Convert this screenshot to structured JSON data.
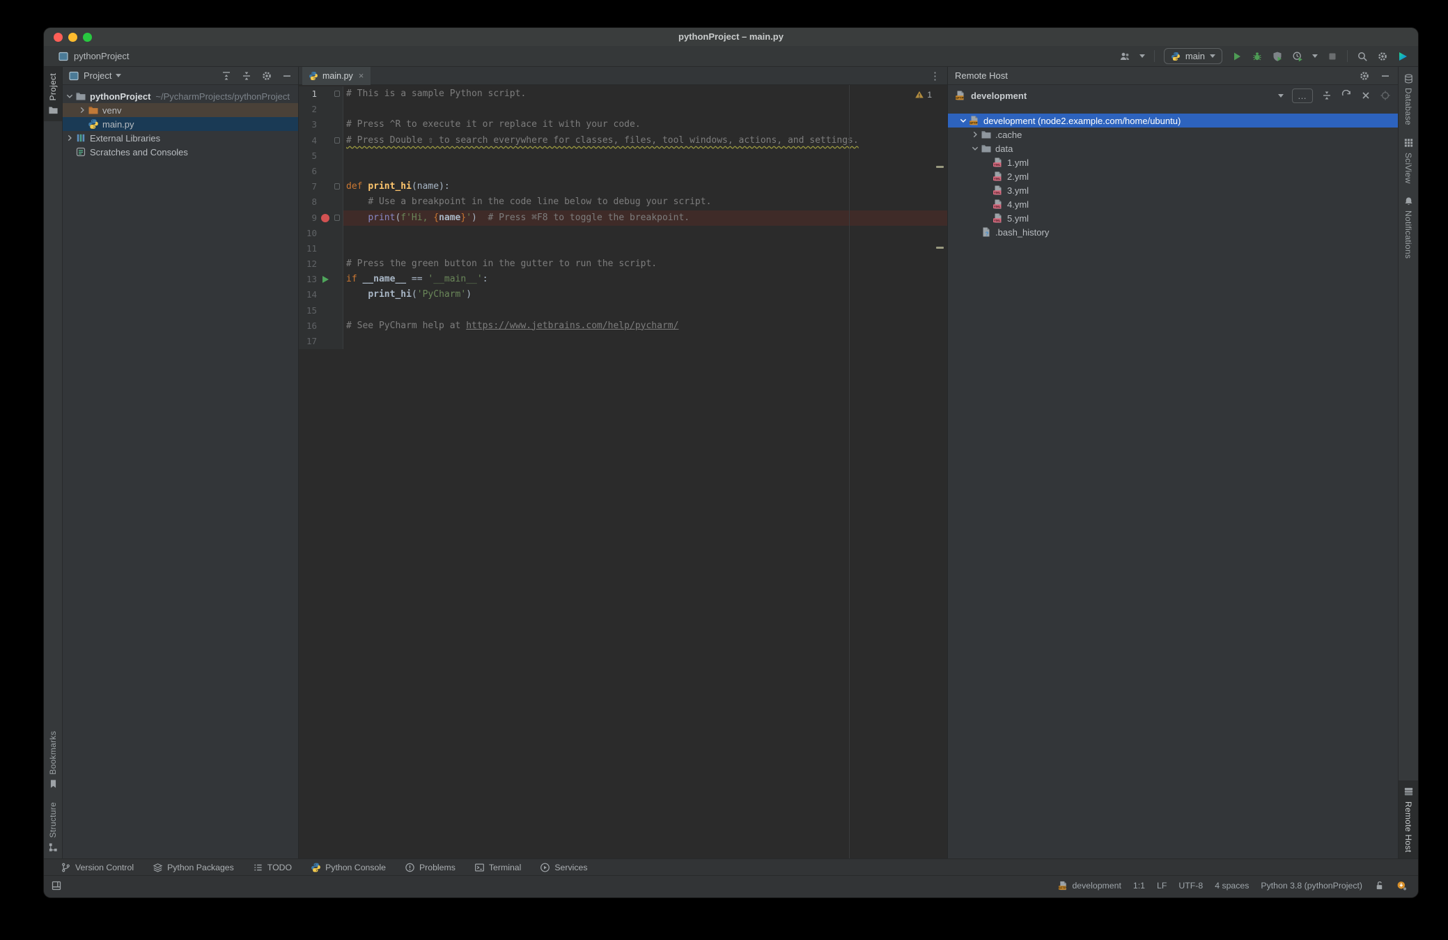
{
  "window": {
    "title": "pythonProject – main.py"
  },
  "navbar": {
    "project_label": "pythonProject",
    "run_config": "main",
    "right_icons": [
      "users",
      "run-pill",
      "play",
      "debug-bug",
      "coverage-shield",
      "profiler-clock",
      "caret",
      "stop",
      "separator",
      "search",
      "gear",
      "jetbrains-logo"
    ]
  },
  "stripes": {
    "left_top": [
      {
        "id": "project",
        "label": "Project",
        "icon": "folder-plain",
        "selected": true
      }
    ],
    "left_bottom": [
      {
        "id": "bookmarks",
        "label": "Bookmarks",
        "icon": "bookmark",
        "selected": false
      },
      {
        "id": "structure",
        "label": "Structure",
        "icon": "structure",
        "selected": false
      }
    ],
    "right_top": [
      {
        "id": "database",
        "label": "Database",
        "icon": "database",
        "selected": false
      },
      {
        "id": "sciview",
        "label": "SciView",
        "icon": "grid",
        "selected": false
      },
      {
        "id": "notifications",
        "label": "Notifications",
        "icon": "bell",
        "selected": false
      }
    ],
    "right_bottom": [
      {
        "id": "remote-host",
        "label": "Remote Host",
        "icon": "server",
        "selected": true
      }
    ]
  },
  "project_panel": {
    "title": "Project",
    "header_icons": [
      "expand-all",
      "collapse-all",
      "gear",
      "hide"
    ],
    "tree": [
      {
        "indent": 0,
        "chevron": "down",
        "icon": "folder",
        "label": "pythonProject",
        "bold": true,
        "suffix": "~/PycharmProjects/pythonProject",
        "row": "none"
      },
      {
        "indent": 1,
        "chevron": "right",
        "icon": "folder-excluded",
        "label": "venv",
        "row": "excluded"
      },
      {
        "indent": 1,
        "chevron": "none",
        "icon": "python",
        "label": "main.py",
        "row": "sel-inactive"
      },
      {
        "indent": 0,
        "chevron": "right",
        "icon": "libraries",
        "label": "External Libraries",
        "row": "none"
      },
      {
        "indent": 0,
        "chevron": "none",
        "icon": "scratches",
        "label": "Scratches and Consoles",
        "row": "none"
      }
    ]
  },
  "editor": {
    "tab_label": "main.py",
    "tab_close": "×",
    "kebab": "⋮",
    "warning_badge": "1",
    "lines": [
      {
        "n": "1",
        "active": true,
        "marks": [
          "fold"
        ],
        "tokens": [
          [
            "com",
            "# This is a sample Python script."
          ]
        ]
      },
      {
        "n": "2",
        "tokens": []
      },
      {
        "n": "3",
        "tokens": [
          [
            "com",
            "# Press ^R to execute it or replace it with your code."
          ]
        ]
      },
      {
        "n": "4",
        "marks": [
          "fold"
        ],
        "tokens": [
          [
            "com typo",
            "# Press Double ⇧ to search everywhere for classes, files, tool windows, actions, and settings."
          ]
        ]
      },
      {
        "n": "5",
        "tokens": []
      },
      {
        "n": "6",
        "tokens": []
      },
      {
        "n": "7",
        "marks": [
          "fold"
        ],
        "tokens": [
          [
            "kw",
            "def "
          ],
          [
            "fn",
            "print_hi"
          ],
          [
            "txt",
            "(name):"
          ]
        ]
      },
      {
        "n": "8",
        "tokens": [
          [
            "txt",
            "    "
          ],
          [
            "com",
            "# Use a breakpoint in the code line below to debug your script."
          ]
        ]
      },
      {
        "n": "9",
        "marks": [
          "breakpoint",
          "fold"
        ],
        "hl": "breakpoint",
        "tokens": [
          [
            "txt",
            "    "
          ],
          [
            "builtin",
            "print"
          ],
          [
            "txt",
            "("
          ],
          [
            "str",
            "f'Hi, "
          ],
          [
            "brace",
            "{"
          ],
          [
            "bold",
            "name"
          ],
          [
            "brace",
            "}"
          ],
          [
            "str",
            "'"
          ],
          [
            "txt",
            ")"
          ],
          [
            "com",
            "  # Press ⌘F8 to toggle the breakpoint."
          ]
        ]
      },
      {
        "n": "10",
        "tokens": []
      },
      {
        "n": "11",
        "tokens": []
      },
      {
        "n": "12",
        "tokens": [
          [
            "com",
            "# Press the green button in the gutter to run the script."
          ]
        ]
      },
      {
        "n": "13",
        "marks": [
          "run"
        ],
        "tokens": [
          [
            "kw",
            "if "
          ],
          [
            "bold",
            "__name__"
          ],
          [
            "txt",
            " == "
          ],
          [
            "str",
            "'__main__'"
          ],
          [
            "txt",
            ":"
          ]
        ]
      },
      {
        "n": "14",
        "tokens": [
          [
            "txt",
            "    "
          ],
          [
            "bold",
            "print_hi"
          ],
          [
            "txt",
            "("
          ],
          [
            "str",
            "'PyCharm'"
          ],
          [
            "txt",
            ")"
          ]
        ]
      },
      {
        "n": "15",
        "tokens": []
      },
      {
        "n": "16",
        "tokens": [
          [
            "com",
            "# See PyCharm help at "
          ],
          [
            "comlink",
            "https://www.jetbrains.com/help/pycharm/"
          ]
        ]
      },
      {
        "n": "17",
        "tokens": []
      }
    ]
  },
  "remote_panel": {
    "title": "Remote Host",
    "combo": "development",
    "more_label": "…",
    "toolbar_icons": [
      "caret",
      "more",
      "collapse-all",
      "refresh",
      "close",
      "target"
    ],
    "tree": [
      {
        "indent": 0,
        "chevron": "down",
        "icon": "sftp",
        "label": "development (node2.example.com/home/ubuntu)",
        "row": "sel-active"
      },
      {
        "indent": 1,
        "chevron": "right",
        "icon": "folder",
        "label": ".cache",
        "row": "none"
      },
      {
        "indent": 1,
        "chevron": "down",
        "icon": "folder",
        "label": "data",
        "row": "none"
      },
      {
        "indent": 2,
        "chevron": "none",
        "icon": "yml",
        "label": "1.yml",
        "row": "none"
      },
      {
        "indent": 2,
        "chevron": "none",
        "icon": "yml",
        "label": "2.yml",
        "row": "none"
      },
      {
        "indent": 2,
        "chevron": "none",
        "icon": "yml",
        "label": "3.yml",
        "row": "none"
      },
      {
        "indent": 2,
        "chevron": "none",
        "icon": "yml",
        "label": "4.yml",
        "row": "none"
      },
      {
        "indent": 2,
        "chevron": "none",
        "icon": "yml",
        "label": "5.yml",
        "row": "none"
      },
      {
        "indent": 1,
        "chevron": "none",
        "icon": "file-unknown",
        "label": ".bash_history",
        "row": "none"
      }
    ]
  },
  "toolwindow_bar": {
    "items": [
      {
        "icon": "branch",
        "label": "Version Control"
      },
      {
        "icon": "packages",
        "label": "Python Packages"
      },
      {
        "icon": "todo",
        "label": "TODO"
      },
      {
        "icon": "python",
        "label": "Python Console"
      },
      {
        "icon": "problems",
        "label": "Problems"
      },
      {
        "icon": "terminal",
        "label": "Terminal"
      },
      {
        "icon": "services",
        "label": "Services"
      }
    ]
  },
  "status_bar": {
    "left_icon": "tool-windows",
    "items": [
      {
        "icon": "sftp",
        "label": "development"
      },
      {
        "label": "1:1"
      },
      {
        "label": "LF"
      },
      {
        "label": "UTF-8"
      },
      {
        "label": "4 spaces"
      },
      {
        "label": "Python 3.8 (pythonProject)"
      },
      {
        "icon": "unlock",
        "label": ""
      },
      {
        "icon": "update",
        "label": ""
      }
    ]
  },
  "colors": {
    "selection_active": "#2D63BE",
    "selection_inactive": "#1A3A55",
    "excluded_row": "#4A4138",
    "breakpoint": "#D25252",
    "breakpoint_line": "#3F2B28",
    "run_green": "#4FA55B",
    "editor_bg": "#2B2B2B",
    "panel_bg": "#333639"
  }
}
